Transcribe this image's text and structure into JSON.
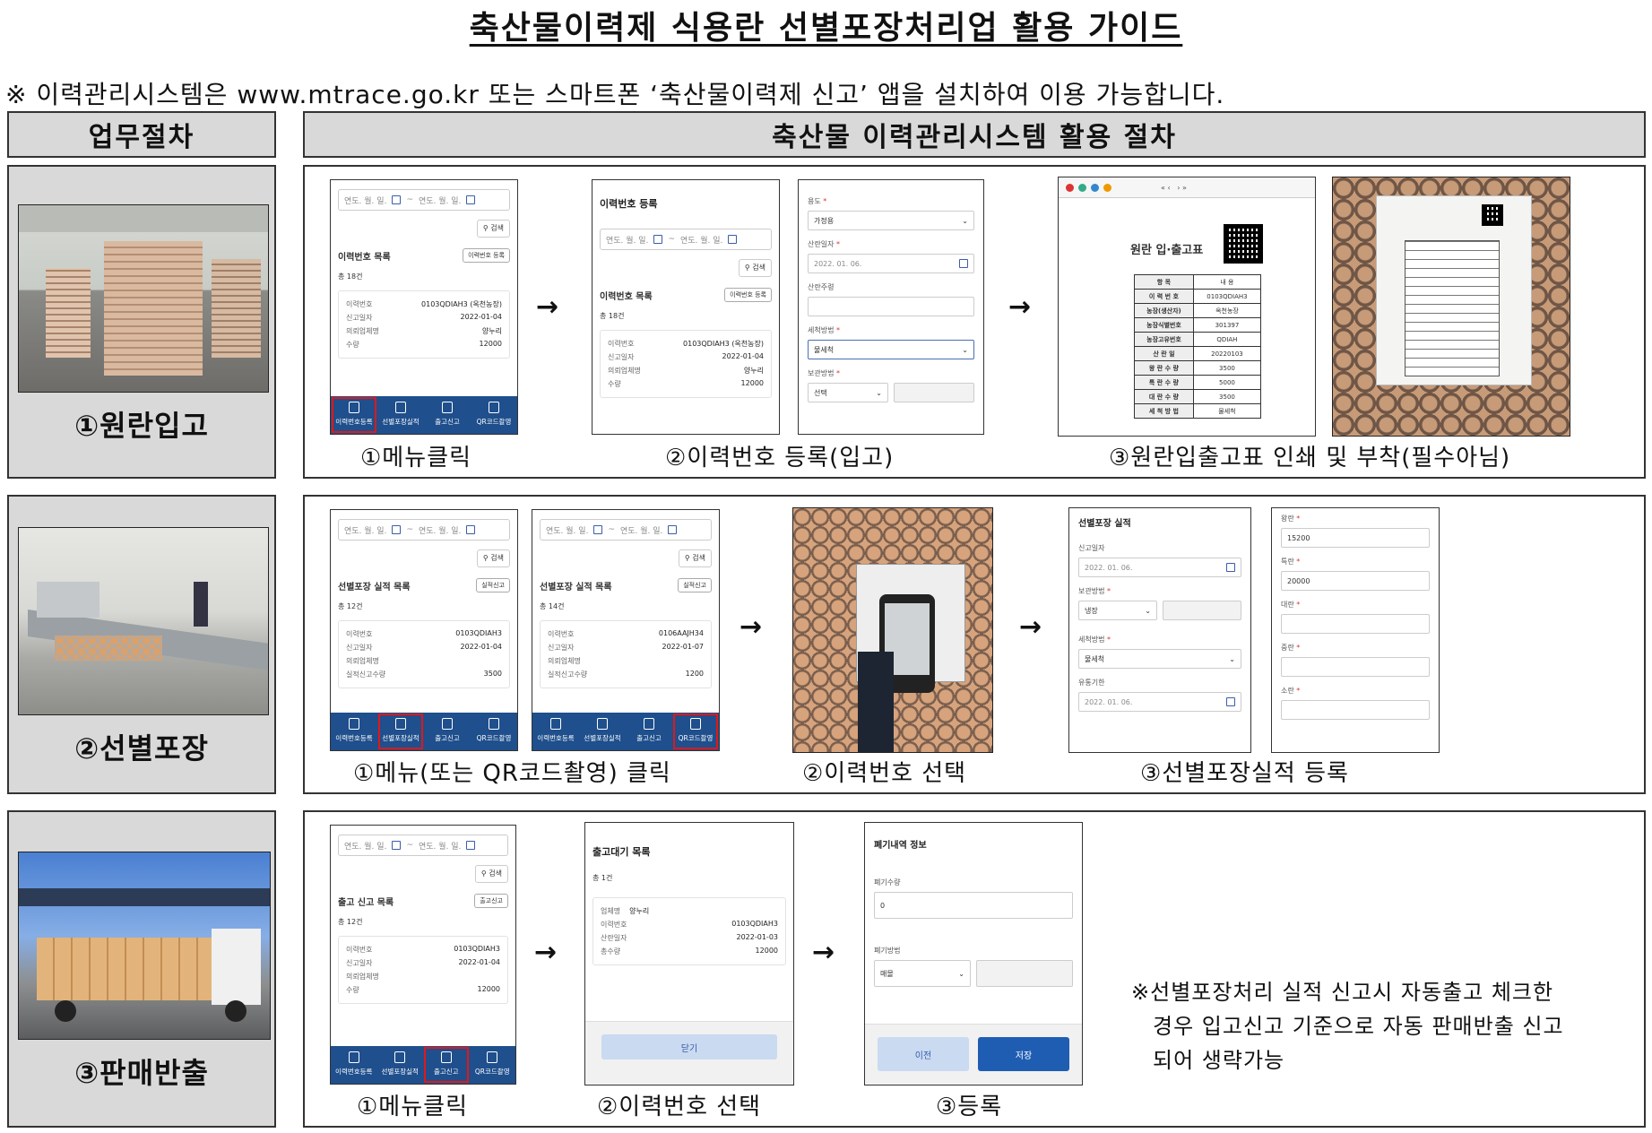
{
  "title": "축산물이력제 식용란 선별포장처리업 활용 가이드",
  "note": "※ 이력관리시스템은 www.mtrace.go.kr 또는 스마트폰 ‘축산물이력제 신고’ 앱을 설치하여 이용 가능합니다.",
  "headers": {
    "left": "업무절차",
    "right": "축산물 이력관리시스템 활용 절차"
  },
  "arrow": "→",
  "common": {
    "date_ph": "연도. 월. 일.",
    "tilde": "~",
    "search": "검색",
    "nav": [
      "이력번호등록",
      "선별포장실적",
      "출고신고",
      "QR코드촬영"
    ],
    "k_trace": "이력번호",
    "k_date": "신고일자",
    "k_company": "의뢰업체명",
    "k_qty": "수량"
  },
  "stage1": {
    "label": "①원란입고",
    "captions": [
      "①메뉴클릭",
      "②이력번호 등록(입고)",
      "③원란입출고표 인쇄 및 부착(필수아님)"
    ],
    "list_title": "이력번호 목록",
    "reg_btn": "이력번호 등록",
    "total": "총 18건",
    "card": {
      "trace": "0103QDIAH3 (옥천농장)",
      "date": "2022-01-04",
      "company": "양누리",
      "qty": "12000"
    },
    "reg_page_title": "이력번호 등록",
    "form": {
      "purpose_label": "용도",
      "purpose_val": "가정용",
      "lay_label": "산란일자",
      "lay_val": "2022. 01. 06.",
      "week_label": "산란주령",
      "wash_label": "세척방법",
      "wash_val": "물세척",
      "store_label": "보관방법",
      "store_val": "선택"
    },
    "slip": {
      "title": "원란 입·출고표",
      "head": [
        "항 목",
        "내 용"
      ],
      "rows": [
        [
          "이 력 번 호",
          "0103QDIAH3"
        ],
        [
          "농장(생산자)",
          "옥천농장"
        ],
        [
          "농장식별번호",
          "301397"
        ],
        [
          "농장고유번호",
          "QDIAH"
        ],
        [
          "산 란 일",
          "20220103"
        ],
        [
          "왕 란 수 량",
          "3500"
        ],
        [
          "특 란 수 량",
          "5000"
        ],
        [
          "대 란 수 량",
          "3500"
        ],
        [
          "세 척 방 법",
          "물세척"
        ]
      ]
    }
  },
  "stage2": {
    "label": "②선별포장",
    "captions": [
      "①메뉴(또는 QR코드촬영) 클릭",
      "②이력번호 선택",
      "③선별포장실적 등록"
    ],
    "list_title": "선별포장 실적 목록",
    "report_btn": "실적신고",
    "k_report_qty": "실적신고수량",
    "phoneA": {
      "total": "총 12건",
      "trace": "0103QDIAH3",
      "date": "2022-01-04",
      "qty": "3500"
    },
    "phoneB": {
      "total": "총 14건",
      "trace": "0106AAJH34",
      "date": "2022-01-07",
      "qty": "1200"
    },
    "form1": {
      "title": "선별포장 실적",
      "date_label": "신고일자",
      "date_val": "2022. 01. 06.",
      "store_label": "보관방법",
      "store_val": "냉장",
      "wash_label": "세척방법",
      "wash_val": "물세척",
      "exp_label": "유통기한",
      "exp_val": "2022. 01. 06."
    },
    "form2": [
      {
        "label": "왕란",
        "val": "15200"
      },
      {
        "label": "특란",
        "val": "20000"
      },
      {
        "label": "대란",
        "val": ""
      },
      {
        "label": "중란",
        "val": ""
      },
      {
        "label": "소란",
        "val": ""
      }
    ]
  },
  "stage3": {
    "label": "③판매반출",
    "captions": [
      "①메뉴클릭",
      "②이력번호 선택",
      "③등록"
    ],
    "list_title": "출고 신고 목록",
    "ship_btn": "출고신고",
    "card": {
      "total": "총 12건",
      "trace": "0103QDIAH3",
      "date": "2022-01-04",
      "qty": "12000"
    },
    "wait": {
      "title": "출고대기 목록",
      "total": "총 1건",
      "k_company": "업체명",
      "company": "양누리",
      "k_trace": "이력번호",
      "trace": "0103QDIAH3",
      "k_lay": "산란일자",
      "lay": "2022-01-03",
      "k_qty": "총수량",
      "qty": "12000",
      "close": "닫기"
    },
    "discard": {
      "title": "폐기내역 정보",
      "qty_label": "폐기수량",
      "qty_val": "0",
      "method_label": "폐기방법",
      "method_val": "매몰",
      "prev": "이전",
      "save": "저장"
    },
    "note_lines": [
      "※선별포장처리 실적 신고시 자동출고 체크한",
      "경우 입고신고 기준으로 자동 판매반출 신고",
      "되어 생략가능"
    ]
  },
  "colors": {
    "nav": "#1f4f8c",
    "highlight": "#e01818",
    "header_bg": "#d9d9d9"
  }
}
